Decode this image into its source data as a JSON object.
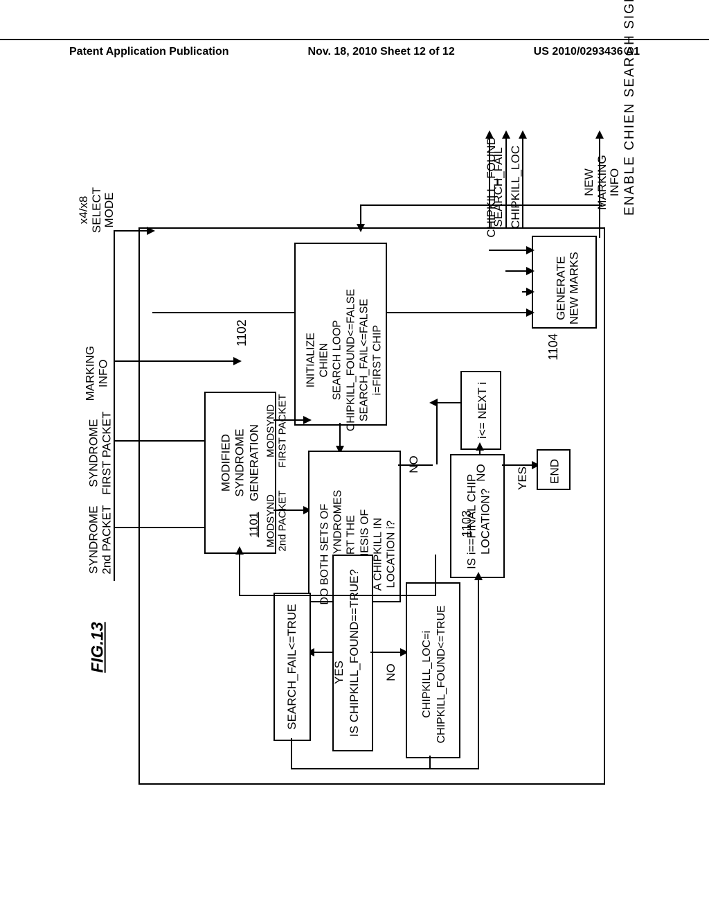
{
  "header": {
    "left": "Patent Application Publication",
    "center": "Nov. 18, 2010  Sheet 12 of 12",
    "right": "US 2010/0293436 A1"
  },
  "figure_label": "FIG.13",
  "inputs": {
    "mode": "x4/x8\nSELECT\nMODE",
    "marking": "MARKING\nINFO",
    "synd1": "SYNDROME\nFIRST PACKET",
    "synd2": "SYNDROME\n2nd PACKET"
  },
  "top_signal": "ENABLE  CHIEN  SEARCH  SIGNAL",
  "outputs": {
    "chipkill_found": "CHIPKILL_FOUND",
    "search_fail": "SEARCH_FAIL",
    "chipkill_loc": "CHIPKILL_LOC",
    "new_marking": "NEW\nMARKING\nINFO"
  },
  "boxes": {
    "gen_marks": "GENERATE\nNEW MARKS",
    "init": "INITIALIZE\nCHIEN\nSEARCH LOOP\nCHIPKILL_FOUND<=FALSE\nSEARCH_FAIL<=FALSE\ni=FIRST CHIP",
    "modsynd_gen": "MODIFIED\nSYNDROME\nGENERATION",
    "modsynd_gen_ref": "1101",
    "hypothesis": "DO BOTH SETS OF\nMODIFIED SYNDROMES\nSUPPORT THE\nHYPOTHESIS OF\nA CHIPKILL IN\nLOCATION i?",
    "next_i": "i<= NEXT i",
    "final_chip": "IS i==FINAL CHIP\nLOCATION?",
    "end": "END",
    "is_found": "IS CHIPKILL_FOUND==TRUE?",
    "search_fail_true": "SEARCH_FAIL<=TRUE",
    "set_loc": "CHIPKILL_LOC=i\nCHIPKILL_FOUND<=TRUE"
  },
  "labels": {
    "modsynd1": "MODSYND\nFIRST PACKET",
    "modsynd2": "MODSYND\n2nd PACKET",
    "yes": "YES",
    "no": "NO"
  },
  "refs": {
    "r1101": "1101",
    "r1102": "1102",
    "r1103": "1103",
    "r1104": "1104"
  }
}
